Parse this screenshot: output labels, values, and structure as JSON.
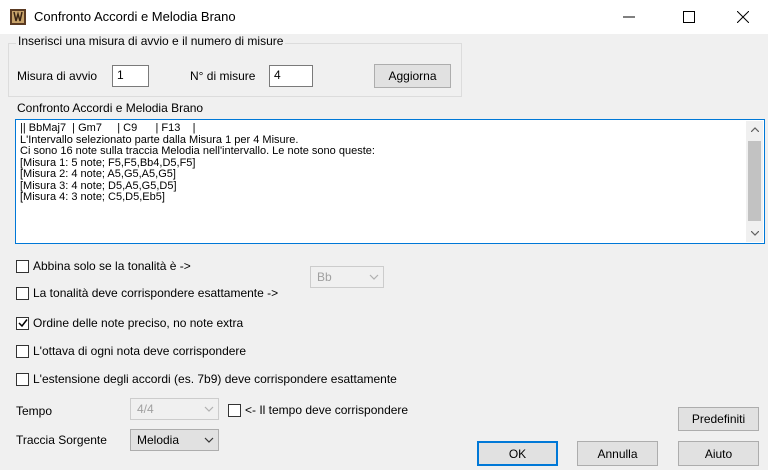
{
  "window": {
    "title": "Confronto Accordi e Melodia Brano",
    "minimize_icon": "minimize-icon",
    "maximize_icon": "maximize-icon",
    "close_icon": "close-icon"
  },
  "range_group": {
    "legend": "Inserisci una misura di avvio e il numero di misure",
    "start_label": "Misura di avvio",
    "start_value": "1",
    "count_label": "N° di misure",
    "count_value": "4",
    "update_button": "Aggiorna"
  },
  "result": {
    "label": "Confronto Accordi e Melodia Brano",
    "lines": [
      "|| BbMaj7  | Gm7     | C9      | F13    |",
      "L'Intervallo selezionato parte dalla Misura 1 per 4 Misure.",
      "Ci sono 16 note sulla traccia Melodia nell'intervallo. Le note sono queste:",
      "[Misura 1: 5 note; F5,F5,Bb4,D5,F5]",
      "[Misura 2: 4 note; A5,G5,A5,G5]",
      "[Misura 3: 4 note; D5,A5,G5,D5]",
      "[Misura 4: 3 note; C5,D5,Eb5]"
    ]
  },
  "options": {
    "match_key_label": "Abbina solo se la tonalità è ->",
    "match_key_checked": false,
    "key_exact_label": "La tonalità deve corrispondere esattamente ->",
    "key_exact_checked": false,
    "key_value": "Bb",
    "note_order_label": "Ordine delle note preciso, no note extra",
    "note_order_checked": true,
    "octave_label": "L'ottava di ogni nota deve corrispondere",
    "octave_checked": false,
    "extension_label": "L'estensione degli accordi (es. 7b9) deve corrispondere esattamente",
    "extension_checked": false
  },
  "tempo": {
    "label": "Tempo",
    "value": "4/4",
    "must_match_label": "<- Il tempo deve corrispondere",
    "must_match_checked": false
  },
  "source": {
    "label": "Traccia Sorgente",
    "value": "Melodia"
  },
  "buttons": {
    "defaults": "Predefiniti",
    "ok": "OK",
    "cancel": "Annulla",
    "help": "Aiuto"
  }
}
